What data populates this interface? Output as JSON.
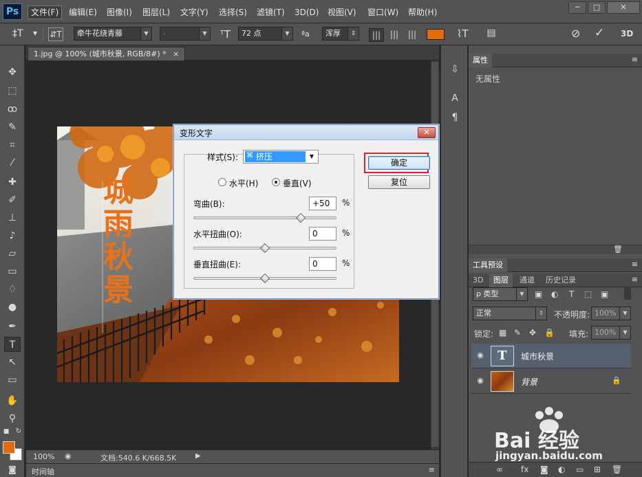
{
  "app": {
    "logo": "Ps"
  },
  "menu": [
    "文件(F)",
    "编辑(E)",
    "图像(I)",
    "图层(L)",
    "文字(Y)",
    "选择(S)",
    "滤镜(T)",
    "3D(D)",
    "视图(V)",
    "窗口(W)",
    "帮助(H)"
  ],
  "window_controls": {
    "minimize": "─",
    "maximize": "□",
    "close": "✕"
  },
  "options": {
    "tool_glyph": "‡T",
    "font_family": "牵牛花绕青藤",
    "font_style": "-",
    "font_size": "72 点",
    "aa_label": "ªa",
    "antialias": "浑厚",
    "text_color": "#e36c0a",
    "label_3d": "3D"
  },
  "document": {
    "tab_label": "1.jpg @ 100% (城市秋景, RGB/8#) *",
    "tab_close": "×",
    "zoom": "100%",
    "doc_size": "文档:540.6 K/668.5K",
    "timeline": "时间轴",
    "canvas_text": "城雨秋景"
  },
  "panels": {
    "properties": {
      "title": "属性",
      "content": "无属性"
    },
    "tool_presets": {
      "title": "工具预设"
    },
    "layers": {
      "tabs": [
        "3D",
        "图层",
        "通道",
        "历史记录"
      ],
      "active_tab": "图层",
      "filter_kind": "ρ 类型",
      "blend_mode": "正常",
      "opacity_label": "不透明度:",
      "opacity_value": "100%",
      "lock_label": "锁定:",
      "fill_label": "填充:",
      "fill_value": "100%",
      "items": [
        {
          "name": "城市秋景",
          "type": "text",
          "thumb_glyph": "T",
          "selected": true
        },
        {
          "name": "背景",
          "type": "image",
          "locked": true,
          "selected": false
        }
      ]
    }
  },
  "dialog": {
    "title": "变形文字",
    "close": "✕",
    "style_label": "样式(S):",
    "style_value": "挤压",
    "horizontal_label": "水平(H)",
    "vertical_label": "垂直(V)",
    "orientation": "垂直",
    "bend_label": "弯曲(B):",
    "bend_value": "+50",
    "bend_level": 50,
    "hdist_label": "水平扭曲(O):",
    "hdist_value": "0",
    "hdist_level": 0,
    "vdist_label": "垂直扭曲(E):",
    "vdist_value": "0",
    "vdist_level": 0,
    "percent": "%",
    "ok_label": "确定",
    "reset_label": "复位"
  },
  "watermark": {
    "brand": "Bai 经验",
    "url": "jingyan.baidu.com"
  }
}
